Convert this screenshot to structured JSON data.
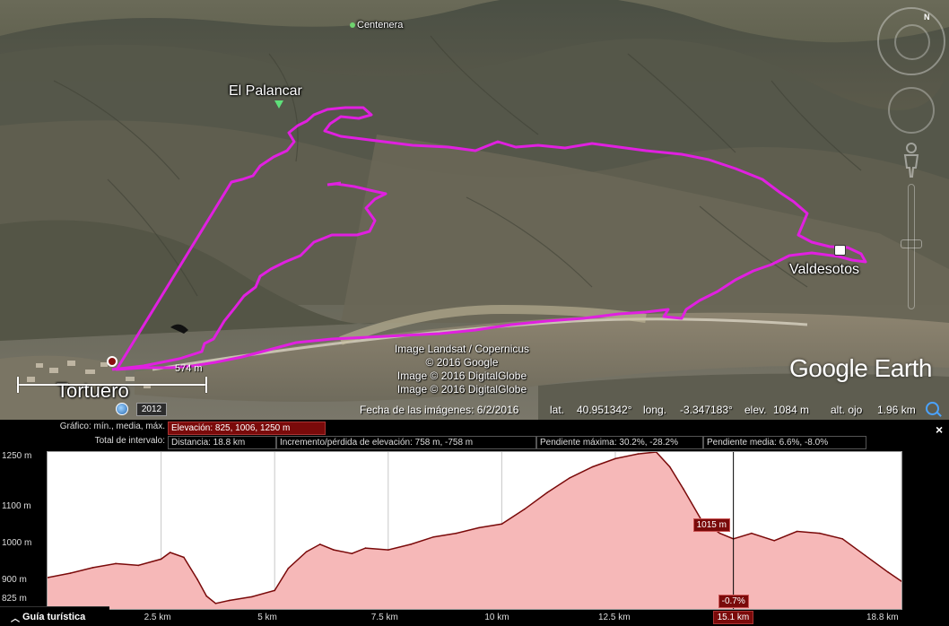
{
  "map": {
    "places": {
      "centenera": "Centenera",
      "el_palancar": "El Palancar",
      "valdesotos": "Valdesotos",
      "tortuero": "Tortuero"
    },
    "attribution": [
      "Image Landsat / Copernicus",
      "© 2016 Google",
      "Image © 2016 DigitalGlobe",
      "Image © 2016 DigitalGlobe"
    ],
    "logo": "Google Earth",
    "scale_label": "574 m",
    "history_year": "2012",
    "compass_letter": "N",
    "track_color": "#e020e0",
    "status": {
      "imagery_date": "Fecha de las imágenes: 6/2/2016",
      "lat_label": "lat.",
      "lat_value": "40.951342°",
      "long_label": "long.",
      "long_value": "-3.347183°",
      "elev_label": "elev.",
      "elev_value": "1084 m",
      "eye_label": "alt. ojo",
      "eye_value": "1.96 km"
    }
  },
  "profile": {
    "close_label": "×",
    "row1_label": "Gráfico: mín., media, máx.",
    "elevation_stats": "Elevación: 825, 1006, 1250 m",
    "row2_label": "Total de intervalo:",
    "distance": "Distancia: 18.8 km",
    "gain_loss": "Incremento/pérdida de elevación: 758 m, -758 m",
    "max_slope": "Pendiente máxima: 30.2%, -28.2%",
    "avg_slope": "Pendiente media: 6.6%, -8.0%",
    "cursor_elevation": "1015 m",
    "cursor_slope": "-0.7%",
    "cursor_distance": "15.1 km",
    "guide_label": "Guía turística",
    "fill_color": "#f6b8b8",
    "line_color": "#7a0a0a"
  },
  "chart_data": {
    "type": "area",
    "title": "",
    "xlabel": "",
    "ylabel": "",
    "x_unit": "km",
    "y_unit": "m",
    "xlim": [
      0,
      18.8
    ],
    "ylim": [
      825,
      1250
    ],
    "y_ticks": [
      {
        "value": 1250,
        "label": "1250 m"
      },
      {
        "value": 1100,
        "label": "1100 m"
      },
      {
        "value": 1000,
        "label": "1000 m"
      },
      {
        "value": 900,
        "label": "900 m"
      },
      {
        "value": 825,
        "label": "825 m"
      }
    ],
    "x_ticks": [
      {
        "value": 2.5,
        "label": "2.5 km"
      },
      {
        "value": 5,
        "label": "5 km"
      },
      {
        "value": 7.5,
        "label": "7.5 km"
      },
      {
        "value": 10,
        "label": "10 km"
      },
      {
        "value": 12.5,
        "label": "12.5 km"
      },
      {
        "value": 18.8,
        "label": "18.8 km"
      }
    ],
    "cursor_x": 15.1,
    "grid": true,
    "series": [
      {
        "x": [
          0,
          0.5,
          1.0,
          1.5,
          2.0,
          2.5,
          2.7,
          3.0,
          3.3,
          3.5,
          3.7,
          4.0,
          4.5,
          5.0,
          5.3,
          5.7,
          6.0,
          6.3,
          6.7,
          7.0,
          7.5,
          8.0,
          8.5,
          9.0,
          9.5,
          10.0,
          10.5,
          11.0,
          11.5,
          12.0,
          12.5,
          13.0,
          13.4,
          13.7,
          14.0,
          14.4,
          14.8,
          15.1,
          15.5,
          16.0,
          16.5,
          17.0,
          17.5,
          18.0,
          18.5,
          18.8
        ],
        "y": [
          910,
          922,
          937,
          948,
          943,
          960,
          978,
          965,
          905,
          860,
          840,
          848,
          858,
          875,
          935,
          980,
          1000,
          985,
          975,
          990,
          985,
          1000,
          1020,
          1030,
          1045,
          1055,
          1095,
          1140,
          1180,
          1210,
          1232,
          1245,
          1250,
          1210,
          1150,
          1065,
          1030,
          1015,
          1030,
          1010,
          1035,
          1030,
          1015,
          970,
          925,
          900
        ]
      }
    ]
  }
}
